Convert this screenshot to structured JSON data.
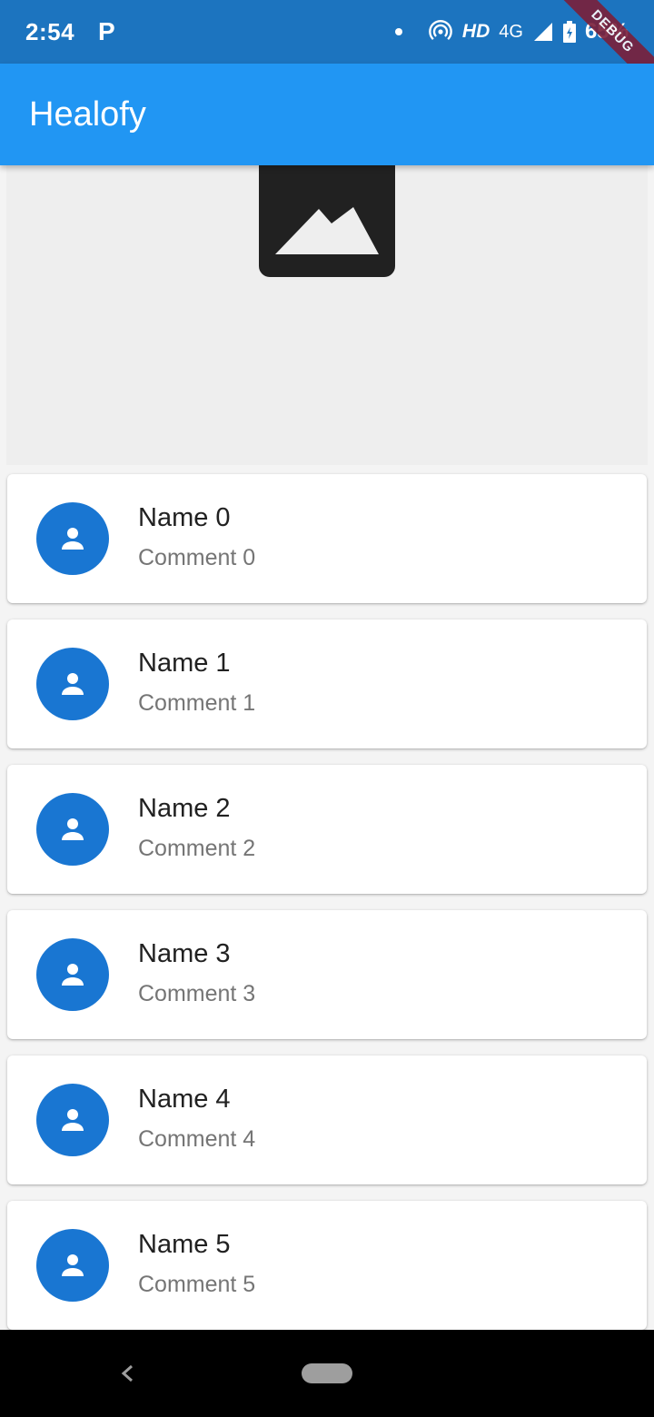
{
  "status_bar": {
    "time": "2:54",
    "app_indicator": "P",
    "hd": "HD",
    "network": "4G",
    "battery": "65%",
    "icons": [
      "notification-dot-icon",
      "hotspot-icon",
      "signal-icon",
      "battery-icon"
    ]
  },
  "debug_banner": "DEBUG",
  "app_bar": {
    "title": "Healofy",
    "color": "#2196f3"
  },
  "hero": {
    "icon": "image-placeholder-icon",
    "background": "#eeeeee"
  },
  "list": {
    "items": [
      {
        "name": "Name 0",
        "comment": "Comment 0"
      },
      {
        "name": "Name 1",
        "comment": "Comment 1"
      },
      {
        "name": "Name 2",
        "comment": "Comment 2"
      },
      {
        "name": "Name 3",
        "comment": "Comment 3"
      },
      {
        "name": "Name 4",
        "comment": "Comment 4"
      },
      {
        "name": "Name 5",
        "comment": "Comment 5"
      }
    ],
    "avatar_icon": "person-icon",
    "avatar_color": "#1976d2"
  },
  "nav_bar": {
    "icons": [
      "back-icon",
      "home-pill-icon"
    ]
  }
}
